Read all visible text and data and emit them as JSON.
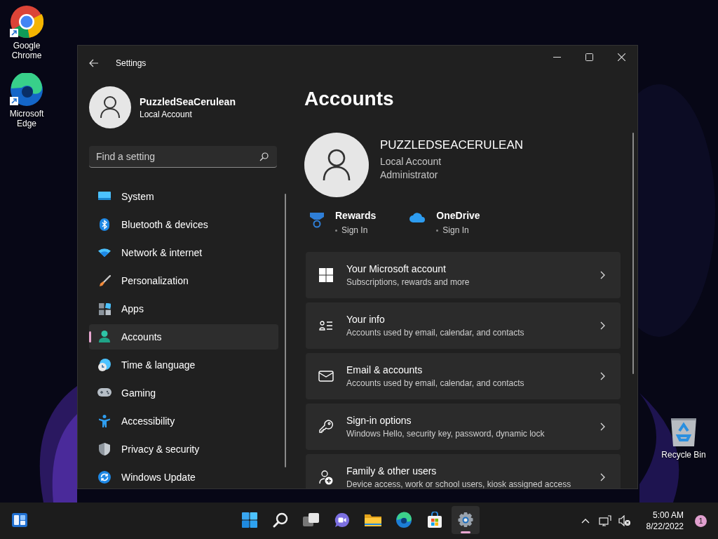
{
  "desktop_icons": [
    {
      "label": "Google Chrome",
      "kind": "chrome"
    },
    {
      "label": "Microsoft Edge",
      "kind": "edge"
    },
    {
      "label": "Recycle Bin",
      "kind": "recycle"
    }
  ],
  "window": {
    "title": "Settings"
  },
  "sidebar": {
    "user": {
      "name": "PuzzledSeaCerulean",
      "account_type": "Local Account"
    },
    "search": {
      "placeholder": "Find a setting"
    },
    "items": [
      {
        "label": "System",
        "kind": "system",
        "selected": false
      },
      {
        "label": "Bluetooth & devices",
        "kind": "bluetooth",
        "selected": false
      },
      {
        "label": "Network & internet",
        "kind": "network",
        "selected": false
      },
      {
        "label": "Personalization",
        "kind": "personalization",
        "selected": false
      },
      {
        "label": "Apps",
        "kind": "apps",
        "selected": false
      },
      {
        "label": "Accounts",
        "kind": "accounts",
        "selected": true
      },
      {
        "label": "Time & language",
        "kind": "time",
        "selected": false
      },
      {
        "label": "Gaming",
        "kind": "gaming",
        "selected": false
      },
      {
        "label": "Accessibility",
        "kind": "accessibility",
        "selected": false
      },
      {
        "label": "Privacy & security",
        "kind": "privacy",
        "selected": false
      },
      {
        "label": "Windows Update",
        "kind": "update",
        "selected": false
      }
    ]
  },
  "page": {
    "title": "Accounts",
    "profile": {
      "name": "PUZZLEDSEACERULEAN",
      "lines": [
        "Local Account",
        "Administrator"
      ]
    },
    "services": [
      {
        "name": "Rewards",
        "status": "Sign In",
        "kind": "rewards"
      },
      {
        "name": "OneDrive",
        "status": "Sign In",
        "kind": "onedrive"
      }
    ],
    "cards": [
      {
        "title": "Your Microsoft account",
        "subtitle": "Subscriptions, rewards and more",
        "kind": "microsoft"
      },
      {
        "title": "Your info",
        "subtitle": "Accounts used by email, calendar, and contacts",
        "kind": "info"
      },
      {
        "title": "Email & accounts",
        "subtitle": "Accounts used by email, calendar, and contacts",
        "kind": "email"
      },
      {
        "title": "Sign-in options",
        "subtitle": "Windows Hello, security key, password, dynamic lock",
        "kind": "key"
      },
      {
        "title": "Family & other users",
        "subtitle": "Device access, work or school users, kiosk assigned access",
        "kind": "family"
      }
    ]
  },
  "taskbar": {
    "apps": [
      {
        "kind": "widgets",
        "selected": false
      },
      {
        "kind": "start",
        "selected": false
      },
      {
        "kind": "search",
        "selected": false
      },
      {
        "kind": "taskview",
        "selected": false
      },
      {
        "kind": "chat",
        "selected": false
      },
      {
        "kind": "explorer",
        "selected": false
      },
      {
        "kind": "edge",
        "selected": false
      },
      {
        "kind": "store",
        "selected": false
      },
      {
        "kind": "settings",
        "selected": true
      }
    ],
    "clock": {
      "time": "5:00 AM",
      "date": "8/22/2022"
    },
    "notification_count": "1"
  }
}
